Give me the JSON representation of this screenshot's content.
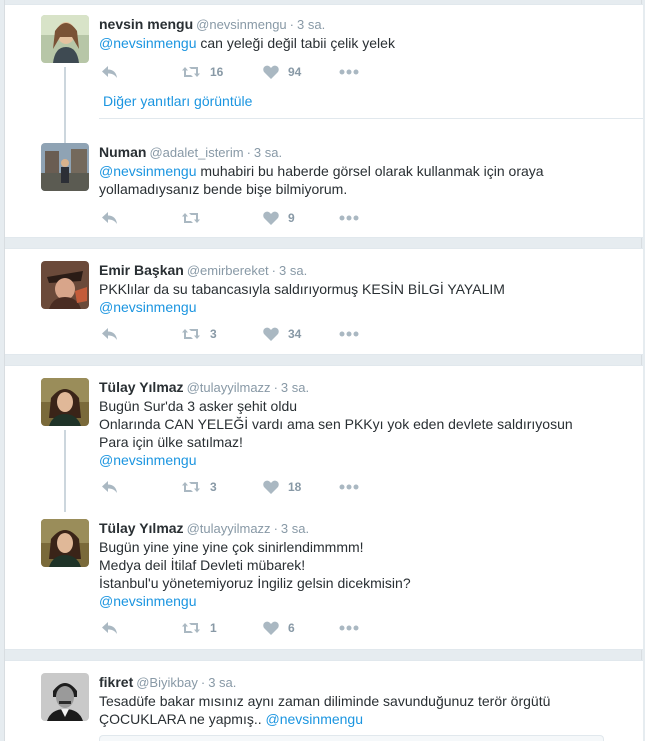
{
  "threads": [
    {
      "tweets": [
        {
          "fullname": "nevsin mengu",
          "username": "@nevsinmengu",
          "time": "3 sa.",
          "lines": [
            {
              "mention": "@nevsinmengu",
              "text": " can yeleği değil tabii çelik yelek"
            }
          ],
          "retweets": "16",
          "likes": "94"
        },
        {
          "fullname": "Numan",
          "username": "@adalet_isterim",
          "time": "3 sa.",
          "lines": [
            {
              "mention": "@nevsinmengu",
              "text": " muhabiri bu haberde görsel olarak kullanmak için oraya"
            },
            {
              "mention": "",
              "text": "yollamadıysanız bende bişe bilmiyorum."
            }
          ],
          "retweets": "",
          "likes": "9"
        }
      ],
      "view_more": "Diğer yanıtları görüntüle"
    },
    {
      "tweets": [
        {
          "fullname": "Emir Başkan",
          "username": "@emirbereket",
          "time": "3 sa.",
          "lines": [
            {
              "mention": "",
              "text": "PKKlılar da su tabancasıyla saldırıyormuş KESİN BİLGİ YAYALIM"
            },
            {
              "mention": "@nevsinmengu",
              "text": ""
            }
          ],
          "retweets": "3",
          "likes": "34"
        }
      ]
    },
    {
      "tweets": [
        {
          "fullname": "Tülay Yılmaz",
          "username": "@tulayyilmazz",
          "time": "3 sa.",
          "lines": [
            {
              "mention": "",
              "text": "Bugün Sur'da 3 asker şehit oldu"
            },
            {
              "mention": "",
              "text": "Onlarında CAN YELEĞİ vardı ama sen PKKyı yok eden devlete saldırıyosun"
            },
            {
              "mention": "",
              "text": "Para için ülke satılmaz!"
            },
            {
              "mention": "@nevsinmengu",
              "text": ""
            }
          ],
          "retweets": "3",
          "likes": "18"
        },
        {
          "fullname": "Tülay Yılmaz",
          "username": "@tulayyilmazz",
          "time": "3 sa.",
          "lines": [
            {
              "mention": "",
              "text": "Bugün yine yine yine çok sinirlendimmmm!"
            },
            {
              "mention": "",
              "text": "Medya deil İtilaf Devleti mübarek!"
            },
            {
              "mention": "",
              "text": "İstanbul'u yönetemiyoruz İngiliz gelsin dicekmisin?"
            },
            {
              "mention": "@nevsinmengu",
              "text": ""
            }
          ],
          "retweets": "1",
          "likes": "6"
        }
      ]
    },
    {
      "tweets": [
        {
          "fullname": "fikret",
          "username": "@Biyikbay",
          "time": "3 sa.",
          "lines": [
            {
              "mention": "",
              "text": "Tesadüfe bakar mısınız aynı zaman diliminde savunduğunuz terör örgütü"
            },
            {
              "mention": "",
              "text": "ÇOCUKLARA ne yapmış.. "
            }
          ],
          "trailing_mention": "@nevsinmengu"
        }
      ]
    }
  ],
  "icons": [
    "reply-icon",
    "retweet-icon",
    "heart-icon",
    "more-icon"
  ],
  "colors": {
    "link": "#1b95e0",
    "muted": "#8899a6",
    "icon": "#aab8c2",
    "background": "#e6ecf0"
  }
}
